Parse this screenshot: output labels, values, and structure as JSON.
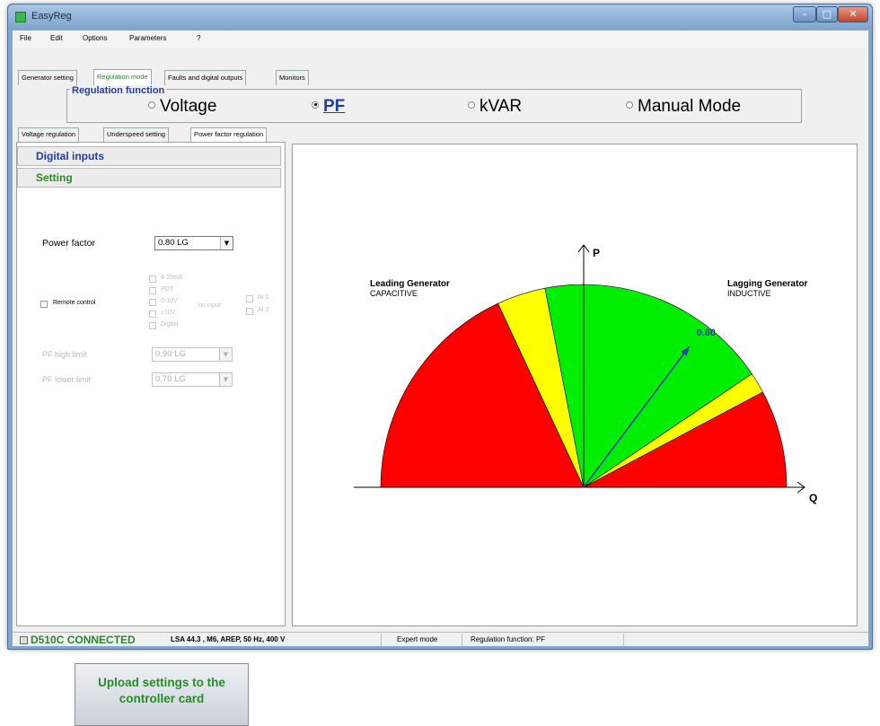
{
  "window": {
    "title": "EasyReg"
  },
  "menu": [
    "File",
    "Edit",
    "Options",
    "Parameters",
    "?"
  ],
  "tabs": [
    {
      "label": "Generator setting",
      "active": false
    },
    {
      "label": "Regulation mode",
      "active": true
    },
    {
      "label": "Faults and digital outputs",
      "active": false
    },
    {
      "label": "Monitors",
      "active": false
    }
  ],
  "regulation_function": {
    "title": "Regulation function",
    "options": [
      {
        "label": "Voltage",
        "selected": false
      },
      {
        "label": "PF",
        "selected": true
      },
      {
        "label": "kVAR",
        "selected": false
      },
      {
        "label": "Manual Mode",
        "selected": false
      }
    ]
  },
  "subtabs": [
    {
      "label": "Voltage regulation",
      "active": false
    },
    {
      "label": "Underspeed setting",
      "active": false
    },
    {
      "label": "Power factor regulation",
      "active": true
    }
  ],
  "left": {
    "digital_inputs": "Digital inputs",
    "setting": "Setting",
    "power_factor_label": "Power factor",
    "power_factor_value": "0.80 LG",
    "remote_control": "Remote control",
    "signal_options": [
      "4-20mA",
      "POT",
      "0-10V",
      "±10V",
      "Digital"
    ],
    "on_input": "on input",
    "inputs": [
      "AI 1",
      "AI 2"
    ],
    "pf_high_limit_label": "PF high limit",
    "pf_high_limit_value": "0.90 LG",
    "pf_lower_limit_label": "PF lower limit",
    "pf_lower_limit_value": "0.70 LG",
    "upload_button": "Upload settings to the controller card"
  },
  "diagram": {
    "axis_p": "P",
    "axis_q": "Q",
    "leading_title": "Leading Generator",
    "leading_sub": "CAPACITIVE",
    "lagging_title": "Lagging Generator",
    "lagging_sub": "INDUCTIVE",
    "pf_value": "0.80",
    "pf_setpoint": 0.8,
    "colors": {
      "red": "#ff0000",
      "yellow": "#ffff00",
      "green": "#00ee00",
      "arrow": "#2a3fb0",
      "label": "#1f3fa8"
    }
  },
  "status": {
    "connection": "D510C CONNECTED",
    "machine": "LSA 44.3 , M6, AREP, 50 Hz, 400 V",
    "mode": "Expert mode",
    "function": "Regulation function: PF"
  }
}
